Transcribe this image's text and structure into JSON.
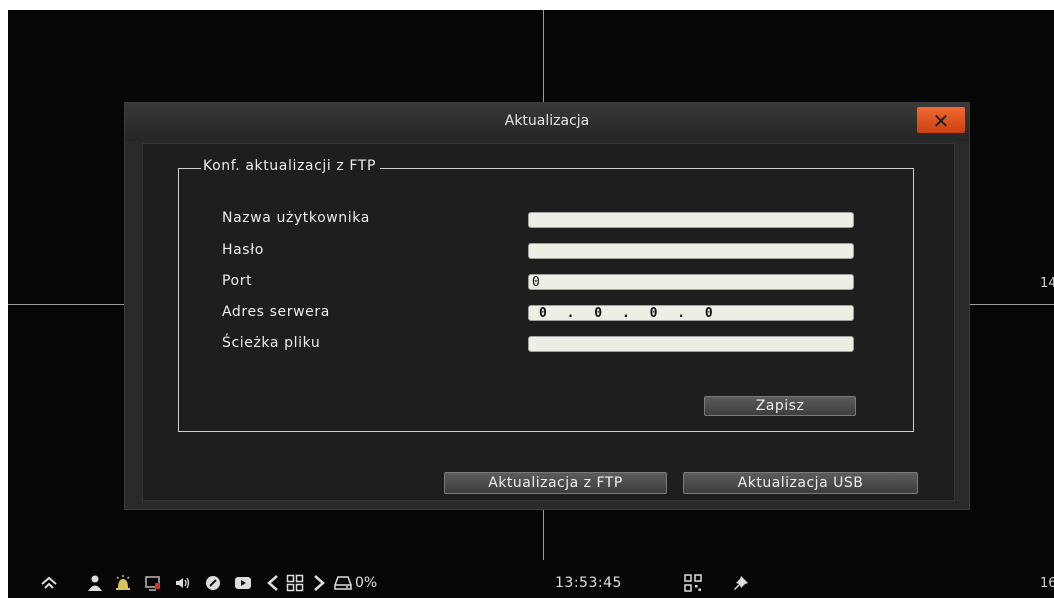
{
  "background": {
    "channel_labels": [
      "14",
      "16"
    ]
  },
  "dialog": {
    "title": "Aktualizacja",
    "close_symbol": "✕",
    "group": {
      "title": "Konf. aktualizacji z FTP",
      "fields": [
        {
          "label": "Nazwa użytkownika",
          "value": ""
        },
        {
          "label": "Hasło",
          "value": ""
        },
        {
          "label": "Port",
          "value": "0"
        },
        {
          "label": "Adres serwera",
          "value": "0 . 0 . 0 . 0"
        },
        {
          "label": "Ścieżka pliku",
          "value": ""
        }
      ],
      "save_label": "Zapisz"
    },
    "ftp_update_label": "Aktualizacja z FTP",
    "usb_update_label": "Aktualizacja USB"
  },
  "taskbar": {
    "icons": [
      "home-icon",
      "user-icon",
      "alarm-icon",
      "monitor-icon",
      "volume-icon",
      "ptz-icon",
      "playback-icon",
      "chevron-left-icon",
      "layout-icon",
      "chevron-right-icon",
      "hdd-icon",
      "qr-icon",
      "pin-icon"
    ],
    "hdd_usage": "0%",
    "time": "13:53:45"
  },
  "colors": {
    "close_button": "#e05220",
    "input_background": "#edeee4",
    "dialog_background": "#1e1e1e"
  }
}
